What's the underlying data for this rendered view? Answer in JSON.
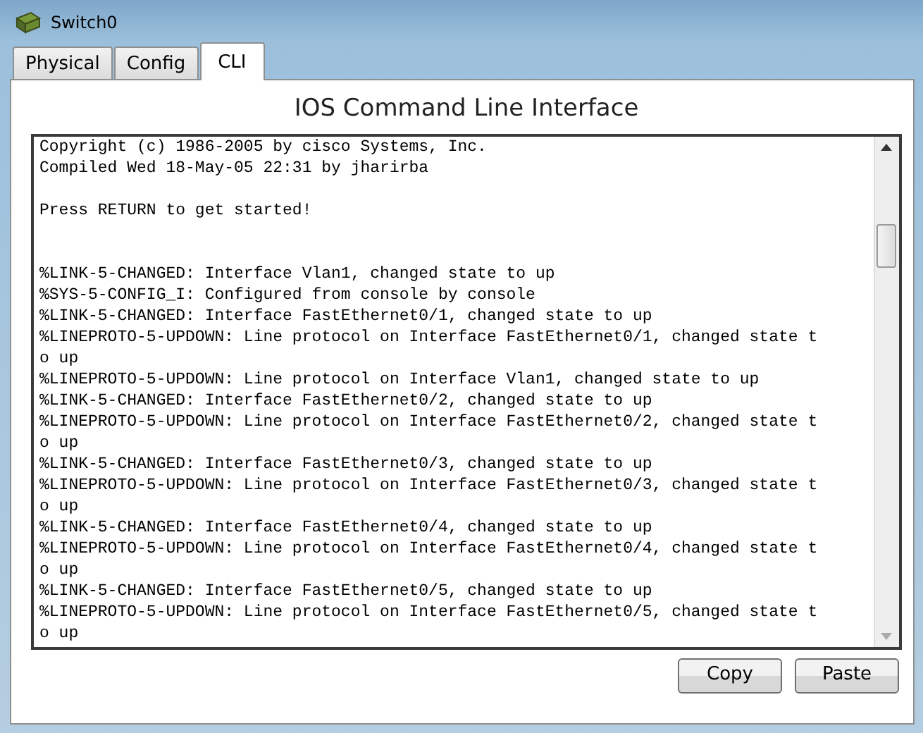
{
  "window": {
    "title": "Switch0"
  },
  "tabs": [
    {
      "label": "Physical",
      "selected": false
    },
    {
      "label": "Config",
      "selected": false
    },
    {
      "label": "CLI",
      "selected": true
    }
  ],
  "heading": "IOS Command Line Interface",
  "console": {
    "lines": [
      {
        "kind": "text",
        "text": "Copyright (c) 1986-2005 by cisco Systems, Inc."
      },
      {
        "kind": "text",
        "text": "Compiled Wed 18-May-05 22:31 by jharirba"
      },
      {
        "kind": "blank"
      },
      {
        "kind": "text",
        "text": "Press RETURN to get started!"
      },
      {
        "kind": "blank"
      },
      {
        "kind": "blank"
      },
      {
        "kind": "text",
        "text": "%LINK-5-CHANGED: Interface Vlan1, changed state to up"
      },
      {
        "kind": "text",
        "text": "%SYS-5-CONFIG_I: Configured from console by console"
      },
      {
        "kind": "text",
        "text": "%LINK-5-CHANGED: Interface FastEthernet0/1, changed state to up"
      },
      {
        "kind": "text",
        "text": "%LINEPROTO-5-UPDOWN: Line protocol on Interface FastEthernet0/1, changed state t"
      },
      {
        "kind": "text",
        "text": "o up"
      },
      {
        "kind": "text",
        "text": "%LINEPROTO-5-UPDOWN: Line protocol on Interface Vlan1, changed state to up"
      },
      {
        "kind": "text",
        "text": "%LINK-5-CHANGED: Interface FastEthernet0/2, changed state to up"
      },
      {
        "kind": "text",
        "text": "%LINEPROTO-5-UPDOWN: Line protocol on Interface FastEthernet0/2, changed state t"
      },
      {
        "kind": "text",
        "text": "o up"
      },
      {
        "kind": "text",
        "text": "%LINK-5-CHANGED: Interface FastEthernet0/3, changed state to up"
      },
      {
        "kind": "text",
        "text": "%LINEPROTO-5-UPDOWN: Line protocol on Interface FastEthernet0/3, changed state t"
      },
      {
        "kind": "text",
        "text": "o up"
      },
      {
        "kind": "text",
        "text": "%LINK-5-CHANGED: Interface FastEthernet0/4, changed state to up"
      },
      {
        "kind": "text",
        "text": "%LINEPROTO-5-UPDOWN: Line protocol on Interface FastEthernet0/4, changed state t"
      },
      {
        "kind": "text",
        "text": "o up"
      },
      {
        "kind": "text",
        "text": "%LINK-5-CHANGED: Interface FastEthernet0/5, changed state to up"
      },
      {
        "kind": "text",
        "text": "%LINEPROTO-5-UPDOWN: Line protocol on Interface FastEthernet0/5, changed state t"
      },
      {
        "kind": "text",
        "text": "o up"
      }
    ]
  },
  "buttons": [
    {
      "label": "Copy"
    },
    {
      "label": "Paste"
    }
  ]
}
